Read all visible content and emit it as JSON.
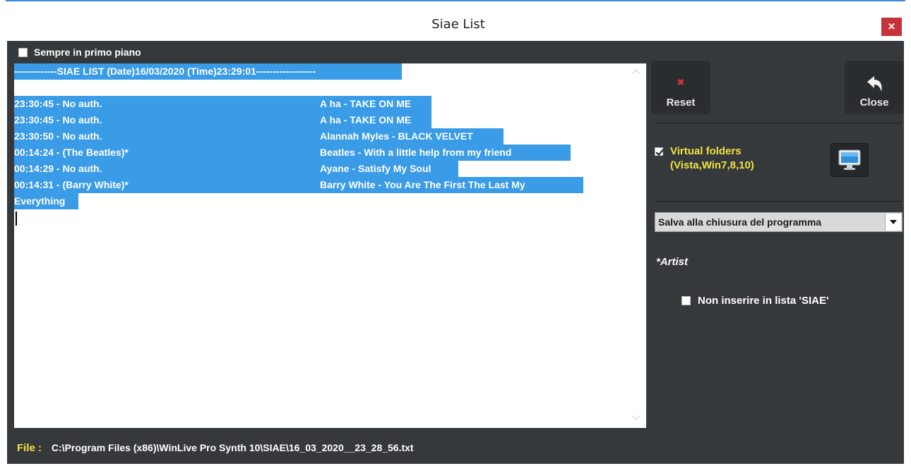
{
  "window": {
    "title": "Siae List",
    "close_glyph": "×"
  },
  "top_checkbox": {
    "label": "Sempre in primo piano",
    "checked": false
  },
  "log": {
    "header": "-------------SIAE LIST  (Date)16/03/2020 (Time)23:29:01------------------",
    "entries": [
      {
        "time": "23:30:45   - No auth.",
        "song": "A ha - TAKE ON ME"
      },
      {
        "time": "23:30:45   - No auth.",
        "song": "A ha - TAKE ON ME"
      },
      {
        "time": "23:30:50   - No auth.",
        "song": "Alannah Myles - BLACK VELVET"
      },
      {
        "time": "00:14:24   - (The Beatles)*",
        "song": "Beatles - With a little help from my friend"
      },
      {
        "time": "00:14:29   - No auth.",
        "song": "Ayane - Satisfy My Soul"
      },
      {
        "time": "00:14:31   - (Barry White)*",
        "song": "Barry White - You Are The First The Last My"
      }
    ],
    "wrap_tail": "Everything",
    "selection_color": "#3a9be7"
  },
  "buttons": {
    "reset_label": "Reset",
    "close_label": "Close"
  },
  "virtual_folders": {
    "line1": "Virtual folders",
    "line2": "(Vista,Win7,8,10)",
    "checked": true,
    "icon": "monitor-icon"
  },
  "save_select": {
    "value": "Salva alla chiusura del programma"
  },
  "artist_note": "*Artist",
  "exclude_checkbox": {
    "label": "Non inserire in lista 'SIAE'",
    "checked": false
  },
  "file": {
    "label": "File :",
    "path": "C:\\Program Files (x86)\\WinLive Pro Synth 10\\SIAE\\16_03_2020__23_28_56.txt"
  },
  "colors": {
    "panel": "#36393c",
    "accent_yellow": "#f2e240",
    "close_red": "#c6323a"
  }
}
